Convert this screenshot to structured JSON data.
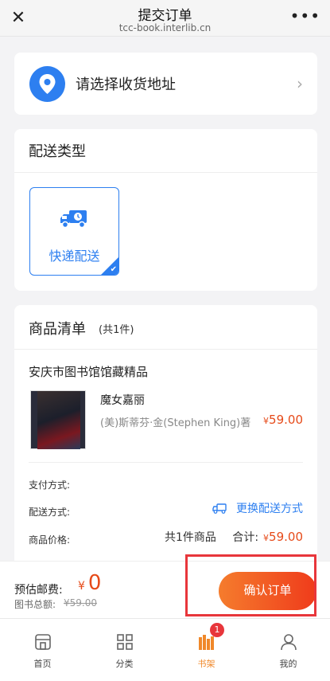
{
  "titlebar": {
    "title": "提交订单",
    "url": "tcc-book.interlib.cn",
    "close_glyph": "✕",
    "more_glyph": "•••"
  },
  "address": {
    "label": "请选择收货地址",
    "icon": "location-pin-icon",
    "chevron": "›"
  },
  "delivery": {
    "heading": "配送类型",
    "option_label": "快递配送",
    "icon": "truck-icon",
    "selected": true
  },
  "goods": {
    "heading": "商品清单",
    "count": "(共1件)",
    "library": "安庆市图书馆馆藏精品",
    "book_title": "魔女嘉丽",
    "book_author": "(美)斯蒂芬·金(Stephen King)著",
    "book_price_symbol": "¥",
    "book_price": "59.00",
    "payment_label": "支付方式:",
    "delivery_label": "配送方式:",
    "change_delivery": "更换配送方式",
    "price_label": "商品价格:",
    "item_count": "共1件商品",
    "total_label": "合计:",
    "total_symbol": "¥",
    "total_amount": "59.00"
  },
  "paybar": {
    "est_label": "预估邮费:",
    "est_currency": "¥",
    "est_amount": "0",
    "book_total_label": "图书总额:",
    "book_total": "¥59.00",
    "confirm_label": "确认订单"
  },
  "tabs": [
    {
      "label": "首页",
      "icon": "home-icon"
    },
    {
      "label": "分类",
      "icon": "grid-icon"
    },
    {
      "label": "书架",
      "icon": "bookshelf-icon",
      "badge": "1",
      "active": true
    },
    {
      "label": "我的",
      "icon": "user-icon"
    }
  ],
  "colors": {
    "accent": "#2d7ff0",
    "price": "#e64a19",
    "active_tab": "#f0882a",
    "badge": "#e8363b"
  }
}
